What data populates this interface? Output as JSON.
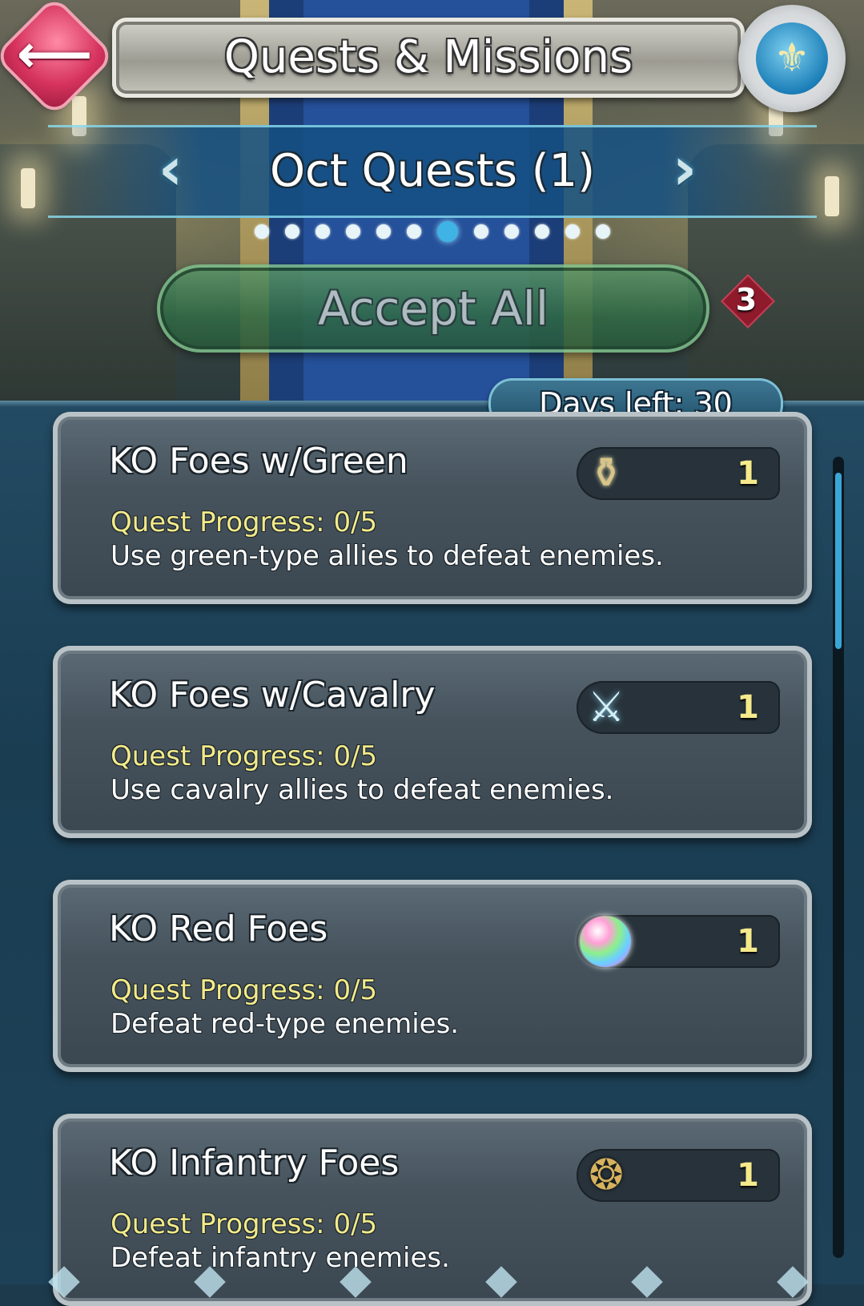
{
  "header": {
    "title": "Quests & Missions",
    "back_icon": "back-arrow-icon",
    "back_glyph": "⟵",
    "badge_icon": "my-nintendo-badge-icon",
    "badge_glyph": "⚜"
  },
  "month_selector": {
    "label": "Oct Quests (1)",
    "prev_glyph": "‹",
    "next_glyph": "›",
    "pages_total": 12,
    "active_page": 7
  },
  "accept_all": {
    "label": "Accept All",
    "count": "3"
  },
  "days_left": "Days left: 30",
  "quests": [
    {
      "title": "KO Foes w/Green",
      "progress": "Quest Progress: 0/5",
      "description": "Use green-type allies to defeat enemies.",
      "reward_icon": "dueling-crest-icon",
      "reward_glyph": "⚱",
      "reward_amount": "1"
    },
    {
      "title": "KO Foes w/Cavalry",
      "progress": "Quest Progress: 0/5",
      "description": "Use cavalry allies to defeat enemies.",
      "reward_icon": "crossed-swords-icon",
      "reward_glyph": "⚔",
      "reward_amount": "1"
    },
    {
      "title": "KO Red Foes",
      "progress": "Quest Progress: 0/5",
      "description": "Defeat red-type enemies.",
      "reward_icon": "orb-icon",
      "reward_glyph": "",
      "reward_amount": "1"
    },
    {
      "title": "KO Infantry Foes",
      "progress": "Quest Progress: 0/5",
      "description": "Defeat infantry enemies.",
      "reward_icon": "amulet-icon",
      "reward_glyph": "❂",
      "reward_amount": "1"
    }
  ],
  "colors": {
    "accent": "#3fb2e6",
    "progress_text": "#f2ea8a",
    "back_button": "#d6335e",
    "accept_button": "#2f6a44"
  }
}
